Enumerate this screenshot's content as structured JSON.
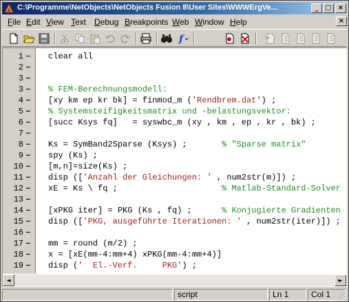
{
  "window": {
    "title": "C:\\Programme\\NetObjects\\NetObjects Fusion 8\\User Sites\\WWWErgVe...",
    "controls": {
      "minimize": "_",
      "maximize": "□",
      "close": "×"
    }
  },
  "menu": [
    "File",
    "Edit",
    "View",
    "Text",
    "Debug",
    "Breakpoints",
    "Web",
    "Window",
    "Help"
  ],
  "toolbar": {
    "icons": [
      "new-file-icon",
      "open-folder-icon",
      "save-icon",
      "cut-icon",
      "copy-icon",
      "paste-icon",
      "undo-icon",
      "redo-icon",
      "print-icon",
      "find-icon",
      "function-icon",
      "set-breakpoint-icon",
      "clear-breakpoint-icon",
      "step-in-icon",
      "step-over-icon",
      "step-out-icon",
      "continue-icon",
      "exit-debug-icon"
    ],
    "function_glyph": "f"
  },
  "editor": {
    "lines": [
      {
        "n": "1",
        "segments": [
          {
            "t": "clear all",
            "k": "plain"
          }
        ]
      },
      {
        "n": "2",
        "segments": []
      },
      {
        "n": "3",
        "segments": []
      },
      {
        "n": "3",
        "segments": [
          {
            "t": "% FEM-Berechnungsmodell:",
            "k": "com"
          }
        ]
      },
      {
        "n": "4",
        "segments": [
          {
            "t": "[xy km ep kr bk] = finmod_m (",
            "k": "plain"
          },
          {
            "t": "'Rendbrem.dat'",
            "k": "str"
          },
          {
            "t": ") ;",
            "k": "plain"
          }
        ]
      },
      {
        "n": "5",
        "segments": [
          {
            "t": "% Systemsteifigkeitsmatrix und -belastungsvektor:",
            "k": "com"
          }
        ]
      },
      {
        "n": "6",
        "segments": [
          {
            "t": "[succ Ksys fq]   = syswbc_m (xy , km , ep , kr , bk) ;",
            "k": "plain"
          }
        ]
      },
      {
        "n": "7",
        "segments": []
      },
      {
        "n": "8",
        "segments": [
          {
            "t": "Ks = SymBand2Sparse (Ksys) ;       ",
            "k": "plain"
          },
          {
            "t": "% \"Sparse matrix\"",
            "k": "com"
          }
        ]
      },
      {
        "n": "9",
        "segments": [
          {
            "t": "spy (Ks) ;",
            "k": "plain"
          }
        ]
      },
      {
        "n": "10",
        "segments": [
          {
            "t": "[m,n]=size(Ks) ;",
            "k": "plain"
          }
        ]
      },
      {
        "n": "11",
        "segments": [
          {
            "t": "disp ([",
            "k": "plain"
          },
          {
            "t": "'Anzahl der Gleichungen: '",
            "k": "str"
          },
          {
            "t": " , num2str(m)]) ;",
            "k": "plain"
          }
        ]
      },
      {
        "n": "12",
        "segments": [
          {
            "t": "xE = Ks \\ fq ;                     ",
            "k": "plain"
          },
          {
            "t": "% Matlab-Standard-Solver",
            "k": "com"
          }
        ]
      },
      {
        "n": "13",
        "segments": []
      },
      {
        "n": "14",
        "segments": [
          {
            "t": "[xPKG iter] = PKG (Ks , fq) ;      ",
            "k": "plain"
          },
          {
            "t": "% Konjugierte Gradienten",
            "k": "com"
          }
        ]
      },
      {
        "n": "15",
        "segments": [
          {
            "t": "disp ([",
            "k": "plain"
          },
          {
            "t": "'PKG, ausgeführte Iterationen: '",
            "k": "str"
          },
          {
            "t": " , num2str(iter)]) ;",
            "k": "plain"
          }
        ]
      },
      {
        "n": "16",
        "segments": []
      },
      {
        "n": "17",
        "segments": [
          {
            "t": "mm = round (m/2) ;",
            "k": "plain"
          }
        ]
      },
      {
        "n": "18",
        "segments": [
          {
            "t": "x = [xE(mm-4:mm+4) xPKG(mm-4:mm+4)]",
            "k": "plain"
          }
        ]
      },
      {
        "n": "19",
        "segments": [
          {
            "t": "disp (",
            "k": "plain"
          },
          {
            "t": "'  El.-Verf.     PKG'",
            "k": "str"
          },
          {
            "t": ") ;",
            "k": "plain"
          }
        ]
      }
    ]
  },
  "scrollbar": {
    "left": "◄",
    "right": "►"
  },
  "status": {
    "mode": "script",
    "line": "Ln 1",
    "col": "Col 1"
  }
}
